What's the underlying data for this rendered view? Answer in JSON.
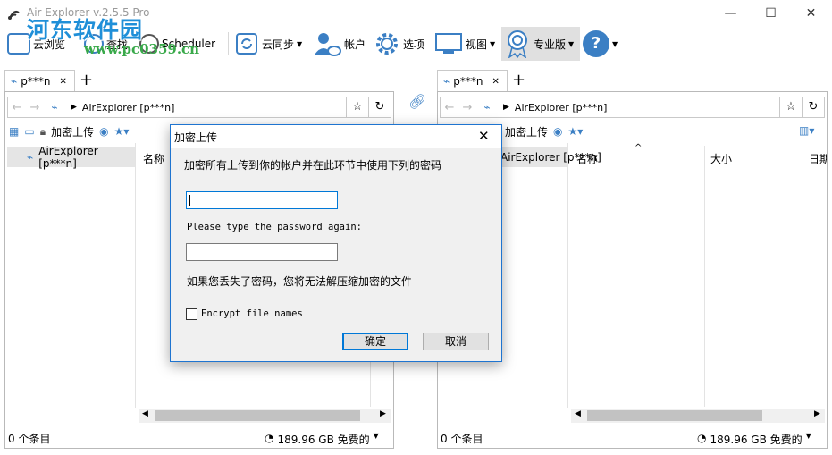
{
  "window": {
    "title": "Air Explorer v.2.5.5 Pro",
    "watermark": "河东软件园",
    "watermark_url": "www.pc0359.cn",
    "min": "—",
    "max": "☐",
    "close": "✕"
  },
  "toolbar": {
    "browse": "云浏览",
    "search": "查找",
    "scheduler": "Scheduler",
    "sync": "云同步",
    "accounts": "帐户",
    "options": "选项",
    "view": "视图",
    "pro": "专业版",
    "help": "?"
  },
  "left": {
    "tab": "p***n",
    "address": "AirExplorer [p***n]",
    "encrypt_upload": "加密上传",
    "tree_item": "AirExplorer [p***n]",
    "col_name": "名称",
    "status_count": "0 个条目",
    "status_free": "189.96 GB 免费的"
  },
  "right": {
    "tab": "p***n",
    "address": "AirExplorer [p***n]",
    "encrypt_upload": "加密上传",
    "tree_item": "AirExplorer [p***n]",
    "col_name": "名称",
    "col_size": "大小",
    "col_date": "日期",
    "status_count": "0 个条目",
    "status_free": "189.96 GB 免费的"
  },
  "dialog": {
    "title": "加密上传",
    "instruction": "加密所有上传到你的帐户并在此环节中使用下列的密码",
    "password_value": "",
    "again_label": "Please type the password again:",
    "password_again_value": "",
    "warning": "如果您丢失了密码，您将无法解压缩加密的文件",
    "encrypt_names": "Encrypt file names",
    "encrypt_names_checked": false,
    "ok": "确定",
    "cancel": "取消",
    "close": "✕"
  },
  "colors": {
    "accent": "#0078d7",
    "watermark_blue": "#1f8fd8",
    "watermark_green": "#39a94a"
  }
}
